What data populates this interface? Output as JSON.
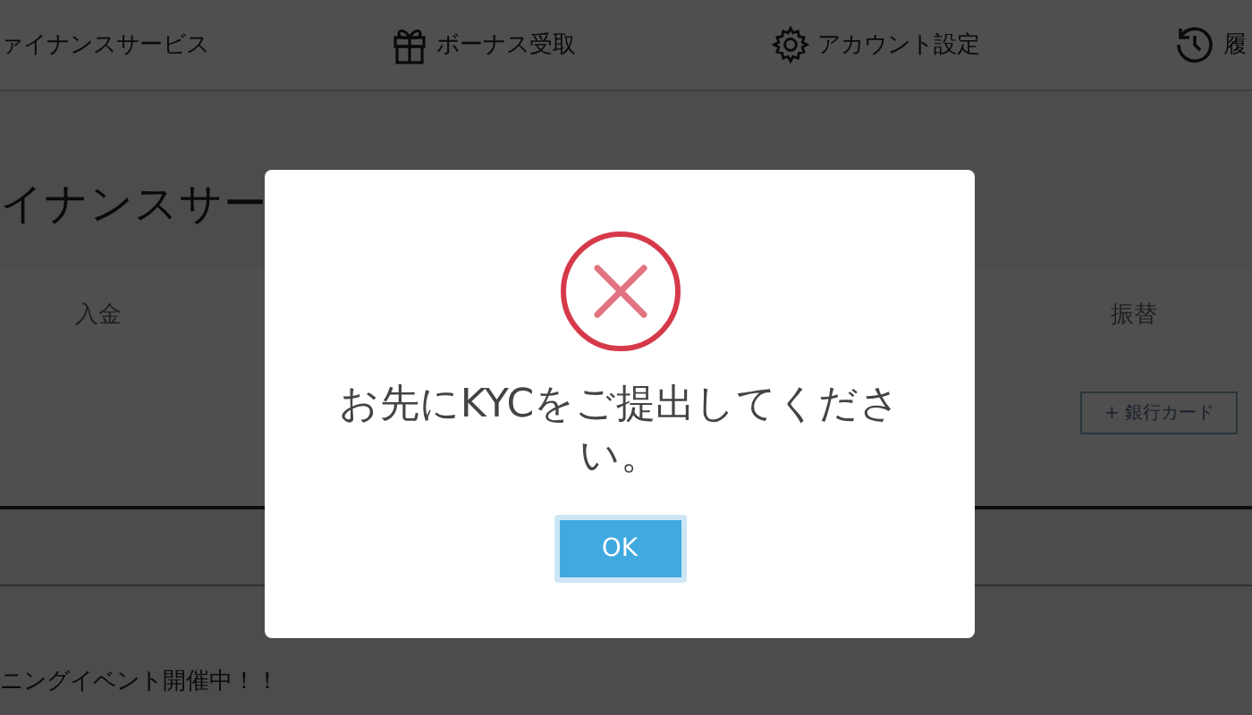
{
  "nav": {
    "items": [
      {
        "label": "ァイナンスサービス"
      },
      {
        "label": "ボーナス受取"
      },
      {
        "label": "アカウント設定"
      },
      {
        "label": "履"
      }
    ]
  },
  "page": {
    "title": "イナンスサー",
    "columns": [
      "入金",
      "振替"
    ],
    "card_button": "+ 銀行カード",
    "banner": "ニングイベント開催中！！"
  },
  "dialog": {
    "kind": "error",
    "message": "お先にKYCをご提出してください。",
    "button": "OK"
  }
}
